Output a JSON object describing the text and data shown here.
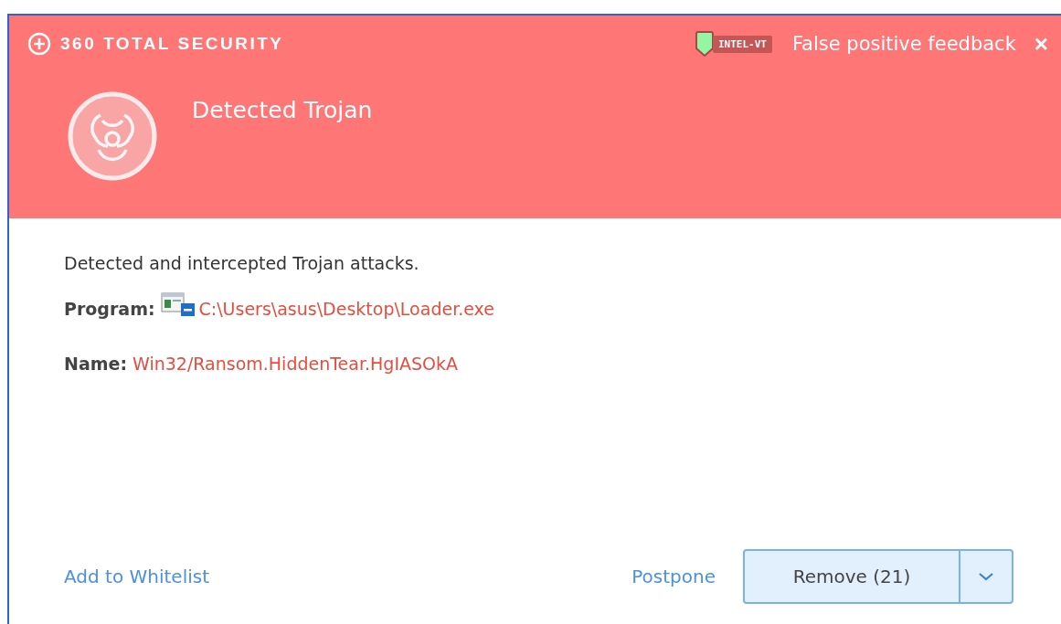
{
  "header": {
    "brand": "360 TOTAL SECURITY",
    "badge": "INTEL-VT",
    "feedback_link": "False positive feedback",
    "close": "×",
    "title": "Detected Trojan"
  },
  "body": {
    "message": "Detected and intercepted Trojan attacks.",
    "fields": [
      {
        "label": "Program:",
        "value": "C:\\Users\\asus\\Desktop\\Loader.exe",
        "kind": "file"
      },
      {
        "label": "Name:",
        "value": "Win32/Ransom.HiddenTear.HgIASOkA",
        "kind": "plain"
      }
    ]
  },
  "footer": {
    "whitelist_link": "Add to Whitelist",
    "postpone_link": "Postpone",
    "remove_button": "Remove (21)"
  }
}
